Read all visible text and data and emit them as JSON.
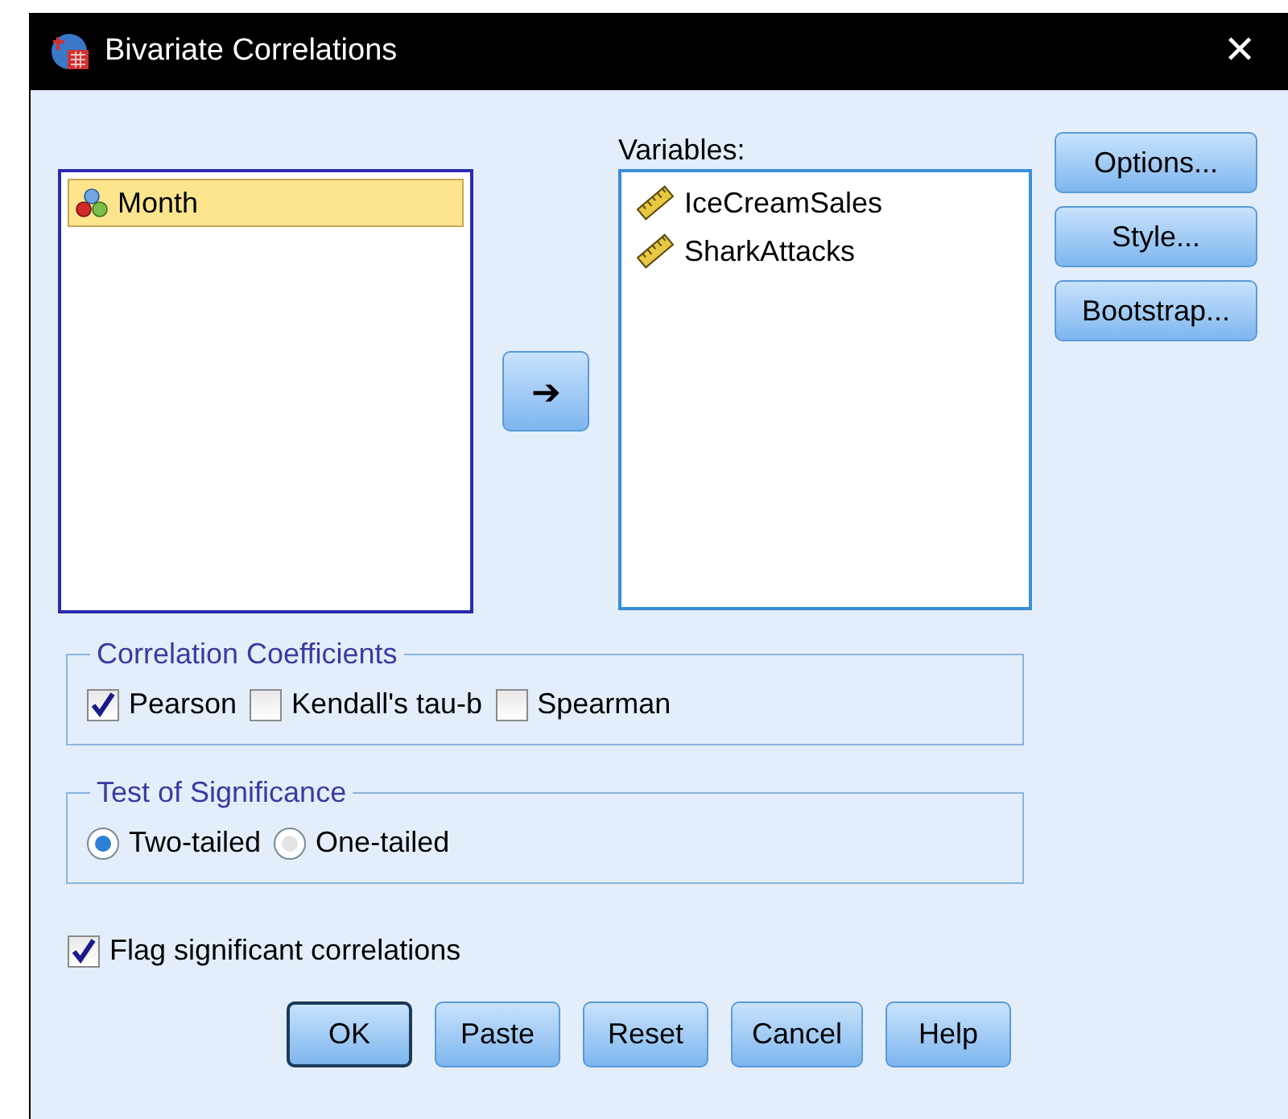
{
  "window": {
    "title": "Bivariate Correlations",
    "close": "✕"
  },
  "source_list": {
    "items": [
      {
        "label": "Month",
        "kind": "nominal",
        "selected": true
      }
    ]
  },
  "move_button": {
    "label": "➔"
  },
  "variables": {
    "label": "Variables:",
    "items": [
      {
        "label": "IceCreamSales",
        "kind": "scale",
        "selected": false
      },
      {
        "label": "SharkAttacks",
        "kind": "scale",
        "selected": false
      }
    ]
  },
  "side_buttons": [
    "Options...",
    "Style...",
    "Bootstrap..."
  ],
  "correlation_coefficients": {
    "title": "Correlation Coefficients",
    "options": [
      {
        "label": "Pearson",
        "checked": true
      },
      {
        "label": "Kendall's tau-b",
        "checked": false
      },
      {
        "label": "Spearman",
        "checked": false
      }
    ]
  },
  "test_of_significance": {
    "title": "Test of Significance",
    "options": [
      {
        "label": "Two-tailed",
        "selected": true
      },
      {
        "label": "One-tailed",
        "selected": false
      }
    ]
  },
  "flag_significant": {
    "label": "Flag significant correlations",
    "checked": true
  },
  "buttons": [
    {
      "label": "OK",
      "default": true
    },
    {
      "label": "Paste",
      "default": false
    },
    {
      "label": "Reset",
      "default": false
    },
    {
      "label": "Cancel",
      "default": false
    },
    {
      "label": "Help",
      "default": false
    }
  ]
}
